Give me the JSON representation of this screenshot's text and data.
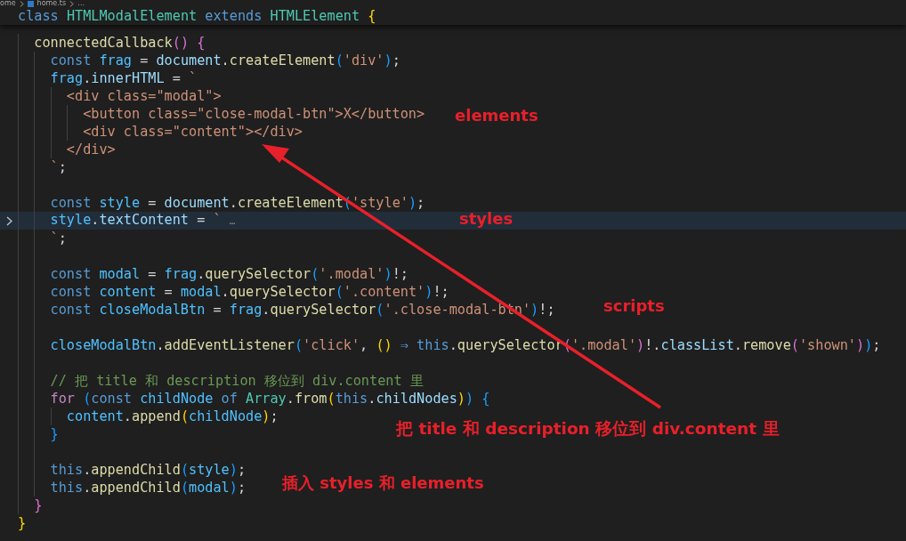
{
  "breadcrumb": {
    "items": [
      {
        "text": "ome",
        "kind": "folder"
      },
      {
        "text": "home.ts",
        "kind": "file"
      },
      {
        "text": "…",
        "kind": "more"
      }
    ]
  },
  "sticky_line": {
    "tokens": [
      {
        "text": "class ",
        "kind": "kw"
      },
      {
        "text": "HTMLModalElement ",
        "kind": "cls"
      },
      {
        "text": "extends ",
        "kind": "kw"
      },
      {
        "text": "HTMLElement ",
        "kind": "cls"
      },
      {
        "text": "{",
        "kind": "b1"
      }
    ]
  },
  "lines": [
    {
      "tokens": [
        {
          "text": "  connectedCallback",
          "kind": "fn"
        },
        {
          "text": "() ",
          "kind": "b2"
        },
        {
          "text": "{",
          "kind": "b2"
        }
      ]
    },
    {
      "tokens": [
        {
          "text": "    const ",
          "kind": "kw"
        },
        {
          "text": "frag",
          "kind": "const"
        },
        {
          "text": " = ",
          "kind": "p"
        },
        {
          "text": "document",
          "kind": "var"
        },
        {
          "text": ".",
          "kind": "p"
        },
        {
          "text": "createElement",
          "kind": "fn"
        },
        {
          "text": "(",
          "kind": "b3"
        },
        {
          "text": "'div'",
          "kind": "str"
        },
        {
          "text": ")",
          "kind": "b3"
        },
        {
          "text": ";",
          "kind": "p"
        }
      ]
    },
    {
      "tokens": [
        {
          "text": "    frag",
          "kind": "const"
        },
        {
          "text": ".",
          "kind": "p"
        },
        {
          "text": "innerHTML",
          "kind": "var"
        },
        {
          "text": " = ",
          "kind": "p"
        },
        {
          "text": "`",
          "kind": "str"
        }
      ]
    },
    {
      "tokens": [
        {
          "text": "      <div class=\"modal\">",
          "kind": "str"
        }
      ]
    },
    {
      "tokens": [
        {
          "text": "        <button class=\"close-modal-btn\">X</button>",
          "kind": "str"
        }
      ]
    },
    {
      "tokens": [
        {
          "text": "        <div class=\"content\"></div>",
          "kind": "str"
        }
      ]
    },
    {
      "tokens": [
        {
          "text": "      </div>",
          "kind": "str"
        }
      ]
    },
    {
      "tokens": [
        {
          "text": "    `",
          "kind": "str"
        },
        {
          "text": ";",
          "kind": "p"
        }
      ]
    },
    {
      "kind": "blank"
    },
    {
      "tokens": [
        {
          "text": "    const ",
          "kind": "kw"
        },
        {
          "text": "style",
          "kind": "const"
        },
        {
          "text": " = ",
          "kind": "p"
        },
        {
          "text": "document",
          "kind": "var"
        },
        {
          "text": ".",
          "kind": "p"
        },
        {
          "text": "createElement",
          "kind": "fn"
        },
        {
          "text": "(",
          "kind": "b3"
        },
        {
          "text": "'style'",
          "kind": "str"
        },
        {
          "text": ")",
          "kind": "b3"
        },
        {
          "text": ";",
          "kind": "p"
        }
      ]
    },
    {
      "current": true,
      "folded": true,
      "tokens": [
        {
          "text": "    style",
          "kind": "const"
        },
        {
          "text": ".",
          "kind": "p"
        },
        {
          "text": "textContent",
          "kind": "var"
        },
        {
          "text": " = ",
          "kind": "p"
        },
        {
          "text": "` ",
          "kind": "str"
        },
        {
          "text": "…",
          "kind": "fold"
        }
      ]
    },
    {
      "tokens": [
        {
          "text": "    `",
          "kind": "str"
        },
        {
          "text": ";",
          "kind": "p"
        }
      ]
    },
    {
      "kind": "blank"
    },
    {
      "tokens": [
        {
          "text": "    const ",
          "kind": "kw"
        },
        {
          "text": "modal",
          "kind": "const"
        },
        {
          "text": " = ",
          "kind": "p"
        },
        {
          "text": "frag",
          "kind": "const"
        },
        {
          "text": ".",
          "kind": "p"
        },
        {
          "text": "querySelector",
          "kind": "fn"
        },
        {
          "text": "(",
          "kind": "b3"
        },
        {
          "text": "'.modal'",
          "kind": "str"
        },
        {
          "text": ")",
          "kind": "b3"
        },
        {
          "text": "!;",
          "kind": "p"
        }
      ]
    },
    {
      "tokens": [
        {
          "text": "    const ",
          "kind": "kw"
        },
        {
          "text": "content",
          "kind": "const"
        },
        {
          "text": " = ",
          "kind": "p"
        },
        {
          "text": "modal",
          "kind": "const"
        },
        {
          "text": ".",
          "kind": "p"
        },
        {
          "text": "querySelector",
          "kind": "fn"
        },
        {
          "text": "(",
          "kind": "b3"
        },
        {
          "text": "'.content'",
          "kind": "str"
        },
        {
          "text": ")",
          "kind": "b3"
        },
        {
          "text": "!;",
          "kind": "p"
        }
      ]
    },
    {
      "tokens": [
        {
          "text": "    const ",
          "kind": "kw"
        },
        {
          "text": "closeModalBtn",
          "kind": "const"
        },
        {
          "text": " = ",
          "kind": "p"
        },
        {
          "text": "frag",
          "kind": "const"
        },
        {
          "text": ".",
          "kind": "p"
        },
        {
          "text": "querySelector",
          "kind": "fn"
        },
        {
          "text": "(",
          "kind": "b3"
        },
        {
          "text": "'.close-modal-btn'",
          "kind": "str"
        },
        {
          "text": ")",
          "kind": "b3"
        },
        {
          "text": "!;",
          "kind": "p"
        }
      ]
    },
    {
      "kind": "blank"
    },
    {
      "tokens": [
        {
          "text": "    closeModalBtn",
          "kind": "const"
        },
        {
          "text": ".",
          "kind": "p"
        },
        {
          "text": "addEventListener",
          "kind": "fn"
        },
        {
          "text": "(",
          "kind": "b3"
        },
        {
          "text": "'click'",
          "kind": "str"
        },
        {
          "text": ", ",
          "kind": "p"
        },
        {
          "text": "()",
          "kind": "b1"
        },
        {
          "text": " ⇒ ",
          "kind": "kw"
        },
        {
          "text": "this",
          "kind": "kw"
        },
        {
          "text": ".",
          "kind": "p"
        },
        {
          "text": "querySelector",
          "kind": "fn"
        },
        {
          "text": "(",
          "kind": "b2"
        },
        {
          "text": "'.modal'",
          "kind": "str"
        },
        {
          "text": ")",
          "kind": "b2"
        },
        {
          "text": "!.",
          "kind": "p"
        },
        {
          "text": "classList",
          "kind": "var"
        },
        {
          "text": ".",
          "kind": "p"
        },
        {
          "text": "remove",
          "kind": "fn"
        },
        {
          "text": "(",
          "kind": "b2"
        },
        {
          "text": "'shown'",
          "kind": "str"
        },
        {
          "text": ")",
          "kind": "b2"
        },
        {
          "text": ")",
          "kind": "b3"
        },
        {
          "text": ";",
          "kind": "p"
        }
      ]
    },
    {
      "kind": "blank"
    },
    {
      "tokens": [
        {
          "text": "    // 把 title 和 description 移位到 div.content 里",
          "kind": "comment"
        }
      ]
    },
    {
      "tokens": [
        {
          "text": "    for ",
          "kind": "ctrl"
        },
        {
          "text": "(",
          "kind": "b3"
        },
        {
          "text": "const ",
          "kind": "kw"
        },
        {
          "text": "childNode ",
          "kind": "const"
        },
        {
          "text": "of ",
          "kind": "kw"
        },
        {
          "text": "Array",
          "kind": "cls"
        },
        {
          "text": ".",
          "kind": "p"
        },
        {
          "text": "from",
          "kind": "fn"
        },
        {
          "text": "(",
          "kind": "b1"
        },
        {
          "text": "this",
          "kind": "kw"
        },
        {
          "text": ".",
          "kind": "p"
        },
        {
          "text": "childNodes",
          "kind": "var"
        },
        {
          "text": ")",
          "kind": "b1"
        },
        {
          "text": ")",
          "kind": "b3"
        },
        {
          "text": " {",
          "kind": "b3"
        }
      ]
    },
    {
      "tokens": [
        {
          "text": "      content",
          "kind": "const"
        },
        {
          "text": ".",
          "kind": "p"
        },
        {
          "text": "append",
          "kind": "fn"
        },
        {
          "text": "(",
          "kind": "b1"
        },
        {
          "text": "childNode",
          "kind": "const"
        },
        {
          "text": ")",
          "kind": "b1"
        },
        {
          "text": ";",
          "kind": "p"
        }
      ]
    },
    {
      "tokens": [
        {
          "text": "    }",
          "kind": "b3"
        }
      ]
    },
    {
      "kind": "blank"
    },
    {
      "tokens": [
        {
          "text": "    this",
          "kind": "kw"
        },
        {
          "text": ".",
          "kind": "p"
        },
        {
          "text": "appendChild",
          "kind": "fn"
        },
        {
          "text": "(",
          "kind": "b3"
        },
        {
          "text": "style",
          "kind": "const"
        },
        {
          "text": ")",
          "kind": "b3"
        },
        {
          "text": ";",
          "kind": "p"
        }
      ]
    },
    {
      "tokens": [
        {
          "text": "    this",
          "kind": "kw"
        },
        {
          "text": ".",
          "kind": "p"
        },
        {
          "text": "appendChild",
          "kind": "fn"
        },
        {
          "text": "(",
          "kind": "b3"
        },
        {
          "text": "modal",
          "kind": "const"
        },
        {
          "text": ")",
          "kind": "b3"
        },
        {
          "text": ";",
          "kind": "p"
        }
      ]
    },
    {
      "tokens": [
        {
          "text": "  }",
          "kind": "b2"
        }
      ]
    },
    {
      "tokens": [
        {
          "text": "}",
          "kind": "b1"
        }
      ]
    }
  ],
  "annotations": [
    {
      "text": "elements"
    },
    {
      "text": "styles"
    },
    {
      "text": "scripts"
    },
    {
      "text": "把 title 和 description 移位到 div.content 里"
    },
    {
      "text": "插入 styles 和 elements"
    }
  ]
}
